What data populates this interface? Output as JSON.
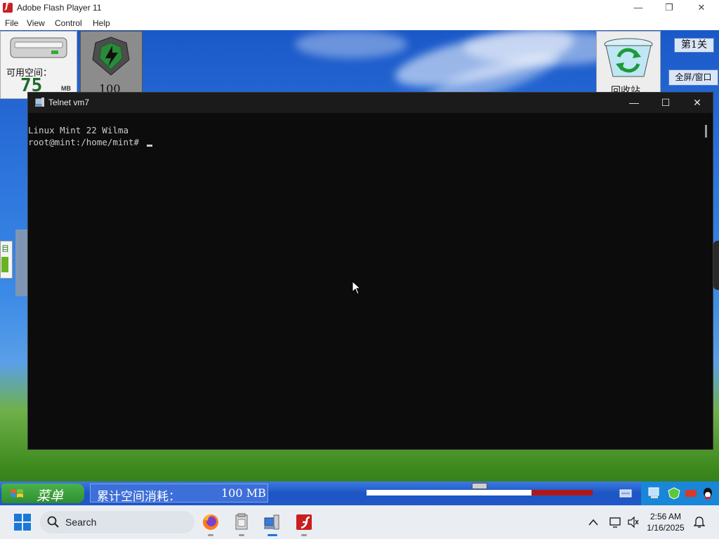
{
  "flash_window": {
    "title": "Adobe Flash Player 11",
    "menu": [
      "File",
      "View",
      "Control",
      "Help"
    ],
    "controls": {
      "minimize": "—",
      "maximize": "❐",
      "close": "✕"
    }
  },
  "game": {
    "free_space_label": "可用空间：",
    "free_space_value": "75",
    "free_space_unit": "MB",
    "shield_value": "100",
    "recycle_label": "回收站",
    "level_button": "第1关",
    "fullscreen_button": "全屏/窗口",
    "side_tile_text": "目",
    "start_label": "菜单",
    "consumed_label": "累计空间消耗：",
    "consumed_value": "100 MB",
    "progress_fraction": 0.73
  },
  "telnet_window": {
    "title": "Telnet vm7",
    "lines": [
      "Linux Mint 22 Wilma",
      "root@mint:/home/mint# "
    ],
    "controls": {
      "minimize": "—",
      "maximize": "☐",
      "close": "✕"
    }
  },
  "taskbar": {
    "search_label": "Search",
    "apps": [
      "firefox-icon",
      "file-manager-icon",
      "telnet-icon",
      "flash-icon"
    ],
    "time": "2:56 AM",
    "date": "1/16/2025"
  },
  "colors": {
    "terminal_bg": "#0c0c0c",
    "terminal_text": "#cccccc",
    "flash_red": "#c8201f",
    "xp_blue": "#2158c6"
  }
}
